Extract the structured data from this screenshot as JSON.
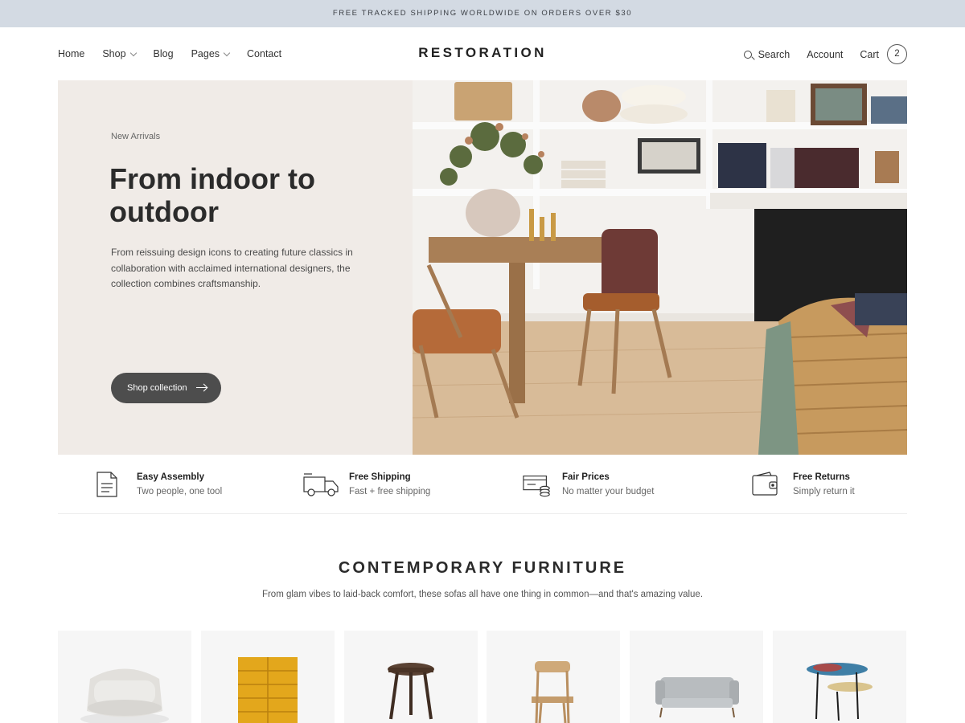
{
  "announcement": "FREE TRACKED SHIPPING WORLDWIDE ON ORDERS OVER $30",
  "header": {
    "logo": "RESTORATION",
    "nav": [
      {
        "label": "Home"
      },
      {
        "label": "Shop"
      },
      {
        "label": "Blog"
      },
      {
        "label": "Pages"
      },
      {
        "label": "Contact"
      }
    ],
    "search_label": "Search",
    "account_label": "Account",
    "cart_label": "Cart",
    "cart_count": "2"
  },
  "hero": {
    "eyebrow": "New Arrivals",
    "title": "From indoor to outdoor",
    "text": "From reissuing design icons to creating future classics in collaboration with acclaimed international designers, the collection combines craftsmanship.",
    "button_label": "Shop collection"
  },
  "features": [
    {
      "icon": "document-icon",
      "title": "Easy Assembly",
      "subtitle": "Two people, one tool"
    },
    {
      "icon": "truck-icon",
      "title": "Free Shipping",
      "subtitle": "Fast + free shipping"
    },
    {
      "icon": "coins-icon",
      "title": "Fair Prices",
      "subtitle": "No matter your budget"
    },
    {
      "icon": "wallet-icon",
      "title": "Free Returns",
      "subtitle": "Simply return it"
    }
  ],
  "section": {
    "title": "CONTEMPORARY FURNITURE",
    "subtitle": "From glam vibes to laid-back comfort, these sofas all have one thing in common—and that's amazing value."
  },
  "products": [
    {
      "image": "armchair"
    },
    {
      "image": "yellow-cabinet"
    },
    {
      "image": "stool"
    },
    {
      "image": "wooden-chair"
    },
    {
      "image": "sofa"
    },
    {
      "image": "side-table"
    }
  ],
  "colors": {
    "announce_bg": "#d3dae3",
    "hero_bg": "#f0ebe7",
    "button_bg": "#4d4d4d"
  }
}
